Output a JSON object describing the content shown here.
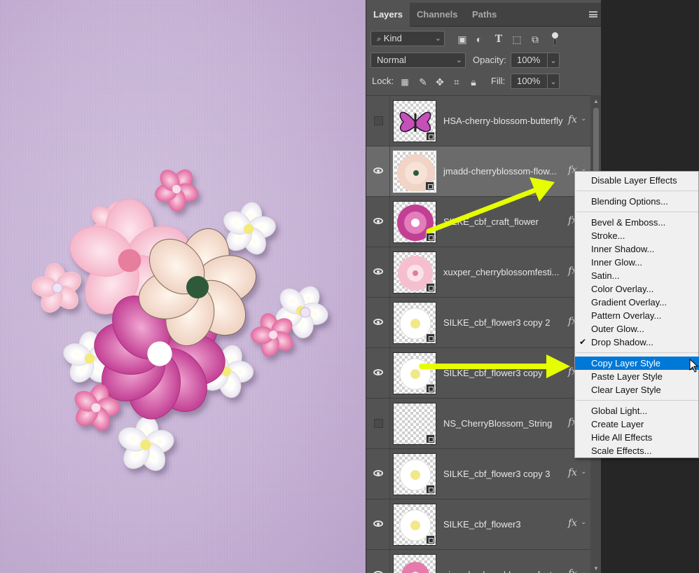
{
  "panel": {
    "tabs": [
      "Layers",
      "Channels",
      "Paths"
    ],
    "filter_label": "Kind",
    "blend_mode": "Normal",
    "opacity_label": "Opacity:",
    "opacity_value": "100%",
    "lock_label": "Lock:",
    "fill_label": "Fill:",
    "fill_value": "100%"
  },
  "layers": [
    {
      "name": "HSA-cherry-blossom-butterfly",
      "visible": false,
      "fx": "fx",
      "thumb": "butterfly"
    },
    {
      "name": "jmadd-cherryblossom-flow...",
      "visible": true,
      "fx": "fx",
      "thumb": "peach-flower",
      "selected": true
    },
    {
      "name": "SILKE_cbf_craft_flower",
      "visible": true,
      "fx": "fx",
      "thumb": "magenta-flower"
    },
    {
      "name": "xuxper_cherryblossomfesti...",
      "visible": true,
      "fx": "fx",
      "thumb": "pink-flower"
    },
    {
      "name": "SILKE_cbf_flower3 copy 2",
      "visible": true,
      "fx": "fx",
      "thumb": "white-flower"
    },
    {
      "name": "SILKE_cbf_flower3 copy",
      "visible": true,
      "fx": "fx",
      "thumb": "white-flower"
    },
    {
      "name": "NS_CherryBlossom_String",
      "visible": false,
      "fx": "fx",
      "thumb": "empty"
    },
    {
      "name": "SILKE_cbf_flower3 copy 3",
      "visible": true,
      "fx": "fx",
      "thumb": "white-flower"
    },
    {
      "name": "SILKE_cbf_flower3",
      "visible": true,
      "fx": "fx",
      "thumb": "white-flower"
    },
    {
      "name": "aimeeh_cherryblossomfest...",
      "visible": true,
      "fx": "fx",
      "thumb": "small-pink"
    }
  ],
  "context_menu": {
    "items": [
      {
        "label": "Disable Layer Effects"
      },
      {
        "sep": true
      },
      {
        "label": "Blending Options..."
      },
      {
        "sep": true
      },
      {
        "label": "Bevel & Emboss..."
      },
      {
        "label": "Stroke..."
      },
      {
        "label": "Inner Shadow..."
      },
      {
        "label": "Inner Glow..."
      },
      {
        "label": "Satin..."
      },
      {
        "label": "Color Overlay..."
      },
      {
        "label": "Gradient Overlay..."
      },
      {
        "label": "Pattern Overlay..."
      },
      {
        "label": "Outer Glow..."
      },
      {
        "label": "Drop Shadow...",
        "checked": true
      },
      {
        "sep": true
      },
      {
        "label": "Copy Layer Style",
        "highlighted": true
      },
      {
        "label": "Paste Layer Style"
      },
      {
        "label": "Clear Layer Style"
      },
      {
        "sep": true
      },
      {
        "label": "Global Light..."
      },
      {
        "label": "Create Layer"
      },
      {
        "label": "Hide All Effects"
      },
      {
        "label": "Scale Effects..."
      }
    ]
  },
  "colors": {
    "canvas": "#c9b6d8",
    "panel": "#535353",
    "highlight": "#0078d7",
    "arrow": "#e6ff00"
  }
}
